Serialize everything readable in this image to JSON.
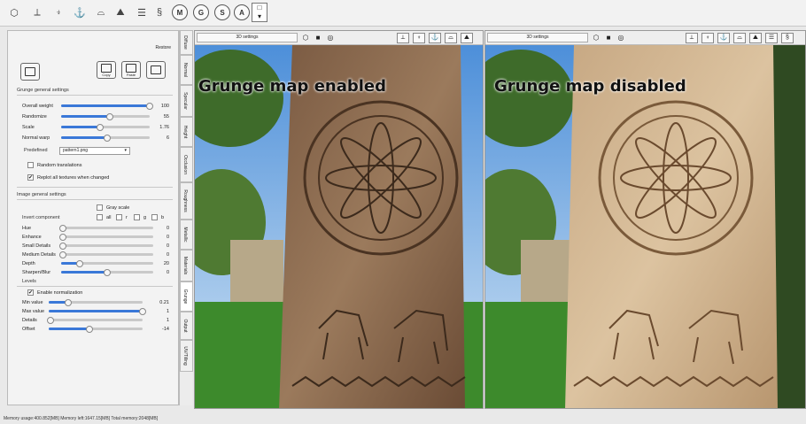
{
  "toolbar": {
    "icons": [
      "cube-icon",
      "plane-axes-icon",
      "anchor-up-icon",
      "anchor-down-icon",
      "bump-icon",
      "terrain-icon",
      "stripes-icon",
      "coil-icon"
    ],
    "circle_buttons": [
      "M",
      "G",
      "S",
      "A"
    ]
  },
  "panel": {
    "restore": "Restore",
    "buttons": {
      "copy": "Copy",
      "paste": "Paste"
    },
    "grunge": {
      "title": "Grunge general settings",
      "sliders": [
        {
          "label": "Overall weight",
          "value": "100",
          "fraction": 1.0
        },
        {
          "label": "Randomize",
          "value": "55",
          "fraction": 0.55
        },
        {
          "label": "Scale",
          "value": "1.76",
          "fraction": 0.44
        },
        {
          "label": "Normal warp",
          "value": "6",
          "fraction": 0.52
        }
      ],
      "predefined_label": "Predefined",
      "predefined_value": "pattern1.png",
      "random_translations": "Random translations",
      "replot": "Replot all textures when changed"
    },
    "image": {
      "title": "Image general settings",
      "grayscale": "Gray scale",
      "invert": "Invert component",
      "rgb": [
        "all",
        "r",
        "g",
        "b"
      ],
      "sliders": [
        {
          "label": "Hue",
          "value": "0",
          "fraction": 0.0
        },
        {
          "label": "Enhance",
          "value": "0",
          "fraction": 0.0
        },
        {
          "label": "Small Details",
          "value": "0",
          "fraction": 0.0
        },
        {
          "label": "Medium Details",
          "value": "0",
          "fraction": 0.0
        },
        {
          "label": "Depth",
          "value": "20",
          "fraction": 0.2
        },
        {
          "label": "Sharpen/Blur",
          "value": "0",
          "fraction": 0.5
        }
      ],
      "levels": "Levels",
      "enable_norm": "Enable normalization",
      "norm_sliders": [
        {
          "label": "Min value",
          "value": "0.21",
          "fraction": 0.21
        },
        {
          "label": "Max value",
          "value": "1",
          "fraction": 1.0
        },
        {
          "label": "Details",
          "value": "1",
          "fraction": 0.0
        },
        {
          "label": "Offset",
          "value": "-14",
          "fraction": 0.43
        }
      ]
    }
  },
  "tabs": [
    "Diffuse",
    "Normal",
    "Specular",
    "Height",
    "Occlusion",
    "Roughness",
    "Metallic",
    "Materials",
    "Grunge",
    "Output",
    "UV/Tilling"
  ],
  "active_tab": "Grunge",
  "views": [
    {
      "settings": "3D settings",
      "caption": "Grunge map enabled"
    },
    {
      "settings": "3D settings",
      "caption": "Grunge map disabled"
    }
  ],
  "status": "Memory usage:400.852[MB] Memory left:1647.15[MB] Total memory:2048[MB]"
}
